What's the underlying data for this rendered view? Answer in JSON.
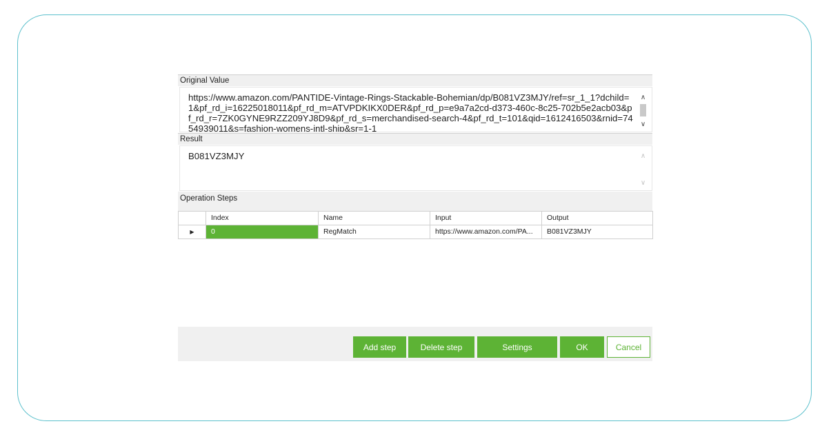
{
  "original_value": {
    "label": "Original Value",
    "text": "https://www.amazon.com/PANTIDE-Vintage-Rings-Stackable-Bohemian/dp/B081VZ3MJY/ref=sr_1_1?dchild=1&pf_rd_i=16225018011&pf_rd_m=ATVPDKIKX0DER&pf_rd_p=e9a7a2cd-d373-460c-8c25-702b5e2acb03&pf_rd_r=7ZK0GYNE9RZZ209YJ8D9&pf_rd_s=merchandised-search-4&pf_rd_t=101&qid=1612416503&rnid=7454939011&s=fashion-womens-intl-ship&sr=1-1"
  },
  "result": {
    "label": "Result",
    "text": "B081VZ3MJY"
  },
  "operation_steps": {
    "label": "Operation Steps",
    "columns": [
      "Index",
      "Name",
      "Input",
      "Output"
    ],
    "rows": [
      {
        "index": "0",
        "name": "RegMatch",
        "input": "https://www.amazon.com/PA...",
        "output": "B081VZ3MJY"
      }
    ]
  },
  "buttons": {
    "add_step": "Add step",
    "delete_step": "Delete step",
    "settings": "Settings",
    "ok": "OK",
    "cancel": "Cancel"
  },
  "icons": {
    "row_pointer": "triangle-right-icon",
    "scroll_up": "chevron-up-icon",
    "scroll_down": "chevron-down-icon"
  },
  "colors": {
    "accent": "#5db335",
    "frame": "#5cc0cc"
  }
}
